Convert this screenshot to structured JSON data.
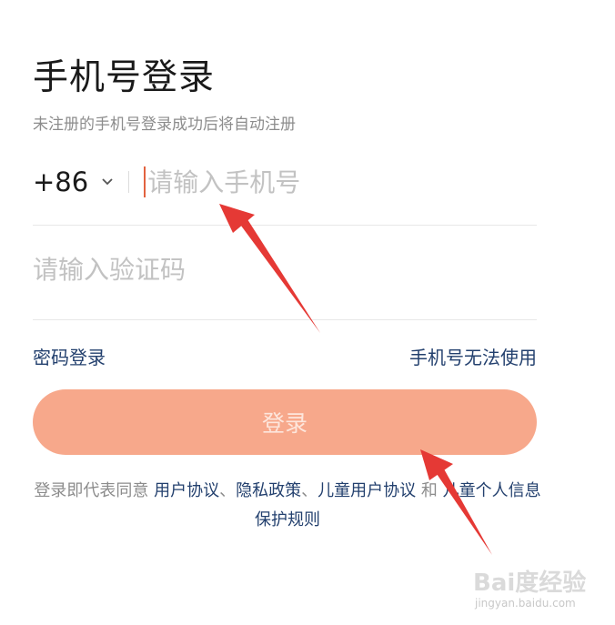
{
  "header": {
    "title": "手机号登录",
    "subtitle": "未注册的手机号登录成功后将自动注册"
  },
  "phone": {
    "country_code": "+86",
    "placeholder": "请输入手机号",
    "value": ""
  },
  "code": {
    "placeholder": "请输入验证码",
    "value": ""
  },
  "links": {
    "password_login": "密码登录",
    "phone_unavailable": "手机号无法使用"
  },
  "login_button": {
    "label": "登录"
  },
  "agreement": {
    "prefix": "登录即代表同意 ",
    "user_agreement": "用户协议",
    "sep1": "、",
    "privacy_policy": "隐私政策",
    "sep2": "、",
    "children_agreement": "儿童用户协议",
    "and": " 和 ",
    "children_privacy": "儿童个人信息保护规则"
  },
  "watermark": {
    "brand": "Bai度经验",
    "url": "jingyan.baidu.com"
  },
  "colors": {
    "accent": "#e2623f",
    "button_bg": "#f7a88b",
    "link": "#23406e",
    "arrow": "#e53935"
  }
}
